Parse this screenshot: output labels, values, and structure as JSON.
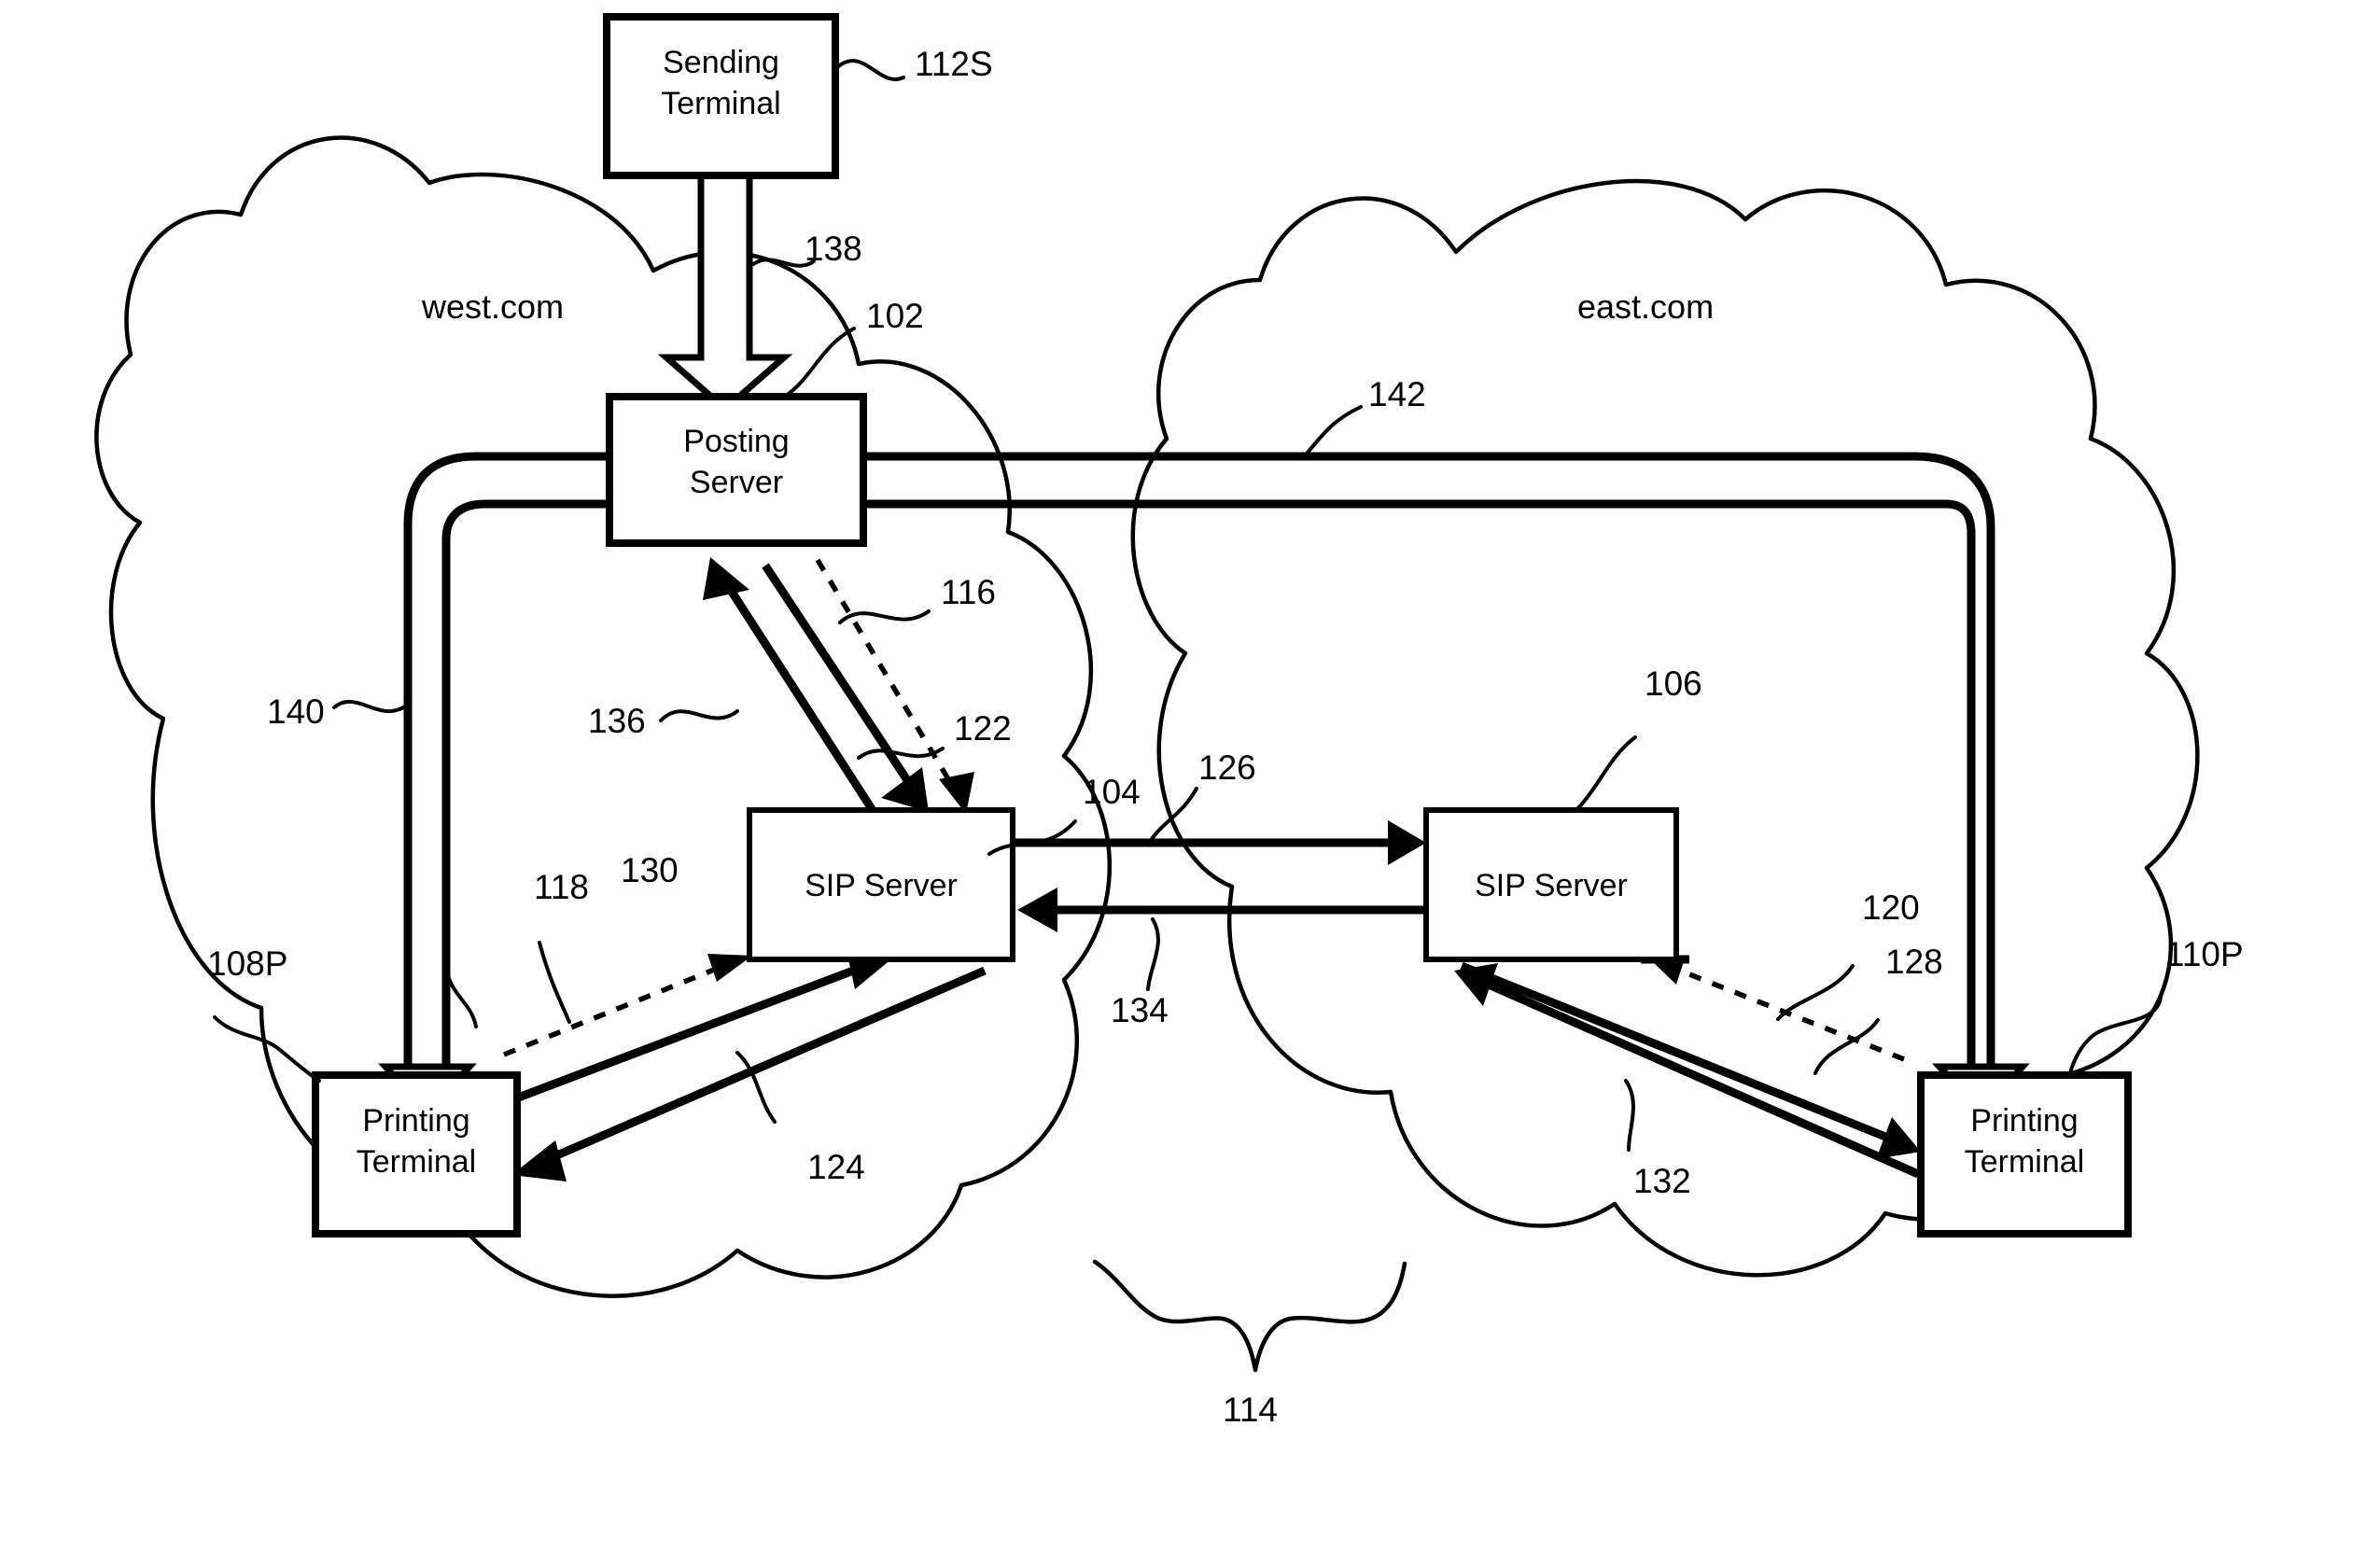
{
  "figure": {
    "type": "patent-network-diagram",
    "title": "Network printing system with posting server and SIP servers"
  },
  "domains": [
    {
      "name": "west-domain",
      "label": "west.com"
    },
    {
      "name": "east-domain",
      "label": "east.com"
    }
  ],
  "nodes": [
    {
      "name": "sending-terminal",
      "label_line1": "Sending",
      "label_line2": "Terminal",
      "ref": "112S"
    },
    {
      "name": "posting-server",
      "label_line1": "Posting",
      "label_line2": "Server",
      "ref": "102"
    },
    {
      "name": "sip-server-west",
      "label_line1": "SIP Server",
      "label_line2": "",
      "ref": "104"
    },
    {
      "name": "sip-server-east",
      "label_line1": "SIP Server",
      "label_line2": "",
      "ref": "106"
    },
    {
      "name": "printing-terminal-west",
      "label_line1": "Printing",
      "label_line2": "Terminal",
      "ref": "108P"
    },
    {
      "name": "printing-terminal-east",
      "label_line1": "Printing",
      "label_line2": "Terminal",
      "ref": "110P"
    }
  ],
  "reference_numerals": [
    {
      "name": "ref-112S",
      "value": "112S"
    },
    {
      "name": "ref-138",
      "value": "138"
    },
    {
      "name": "ref-102",
      "value": "102"
    },
    {
      "name": "ref-142",
      "value": "142"
    },
    {
      "name": "ref-116",
      "value": "116"
    },
    {
      "name": "ref-122",
      "value": "122"
    },
    {
      "name": "ref-104",
      "value": "104"
    },
    {
      "name": "ref-106",
      "value": "106"
    },
    {
      "name": "ref-126",
      "value": "126"
    },
    {
      "name": "ref-134",
      "value": "134"
    },
    {
      "name": "ref-136",
      "value": "136"
    },
    {
      "name": "ref-140",
      "value": "140"
    },
    {
      "name": "ref-118",
      "value": "118"
    },
    {
      "name": "ref-130",
      "value": "130"
    },
    {
      "name": "ref-108P",
      "value": "108P"
    },
    {
      "name": "ref-124",
      "value": "124"
    },
    {
      "name": "ref-120",
      "value": "120"
    },
    {
      "name": "ref-128",
      "value": "128"
    },
    {
      "name": "ref-132",
      "value": "132"
    },
    {
      "name": "ref-110P",
      "value": "110P"
    },
    {
      "name": "ref-114",
      "value": "114"
    }
  ],
  "connections": [
    {
      "name": "conn-138",
      "ref": "138",
      "from": "sending-terminal",
      "to": "posting-server",
      "style": "hollow-arrow"
    },
    {
      "name": "conn-142",
      "ref": "142",
      "from": "posting-server",
      "to": "printing-terminal-east",
      "style": "double-pipe"
    },
    {
      "name": "conn-140",
      "ref": "140",
      "from": "posting-server",
      "to": "printing-terminal-west",
      "style": "double-pipe"
    },
    {
      "name": "conn-136",
      "ref": "136",
      "from": "sip-server-west",
      "to": "posting-server",
      "style": "solid-arrow"
    },
    {
      "name": "conn-122",
      "ref": "122",
      "from": "posting-server",
      "to": "sip-server-west",
      "style": "solid-arrow"
    },
    {
      "name": "conn-116",
      "ref": "116",
      "from": "posting-server",
      "to": "sip-server-west",
      "style": "dashed-arrow"
    },
    {
      "name": "conn-126",
      "ref": "126",
      "from": "sip-server-west",
      "to": "sip-server-east",
      "style": "solid-arrow"
    },
    {
      "name": "conn-134",
      "ref": "134",
      "from": "sip-server-east",
      "to": "sip-server-west",
      "style": "solid-arrow"
    },
    {
      "name": "conn-130",
      "ref": "130",
      "from": "printing-terminal-west",
      "to": "sip-server-west",
      "style": "solid-arrow"
    },
    {
      "name": "conn-124",
      "ref": "124",
      "from": "sip-server-west",
      "to": "printing-terminal-west",
      "style": "solid-arrow"
    },
    {
      "name": "conn-118",
      "ref": "118",
      "from": "sip-server-west",
      "to": "printing-terminal-west",
      "style": "dashed-arrow"
    },
    {
      "name": "conn-132",
      "ref": "132",
      "from": "printing-terminal-east",
      "to": "sip-server-east",
      "style": "solid-arrow"
    },
    {
      "name": "conn-128",
      "ref": "128",
      "from": "sip-server-east",
      "to": "printing-terminal-east",
      "style": "solid-arrow"
    },
    {
      "name": "conn-120",
      "ref": "120",
      "from": "sip-server-east",
      "to": "printing-terminal-east",
      "style": "dashed-arrow"
    }
  ],
  "network": {
    "name": "network-cloud",
    "ref": "114"
  },
  "colors": {
    "stroke": "#000000",
    "background": "#ffffff"
  }
}
